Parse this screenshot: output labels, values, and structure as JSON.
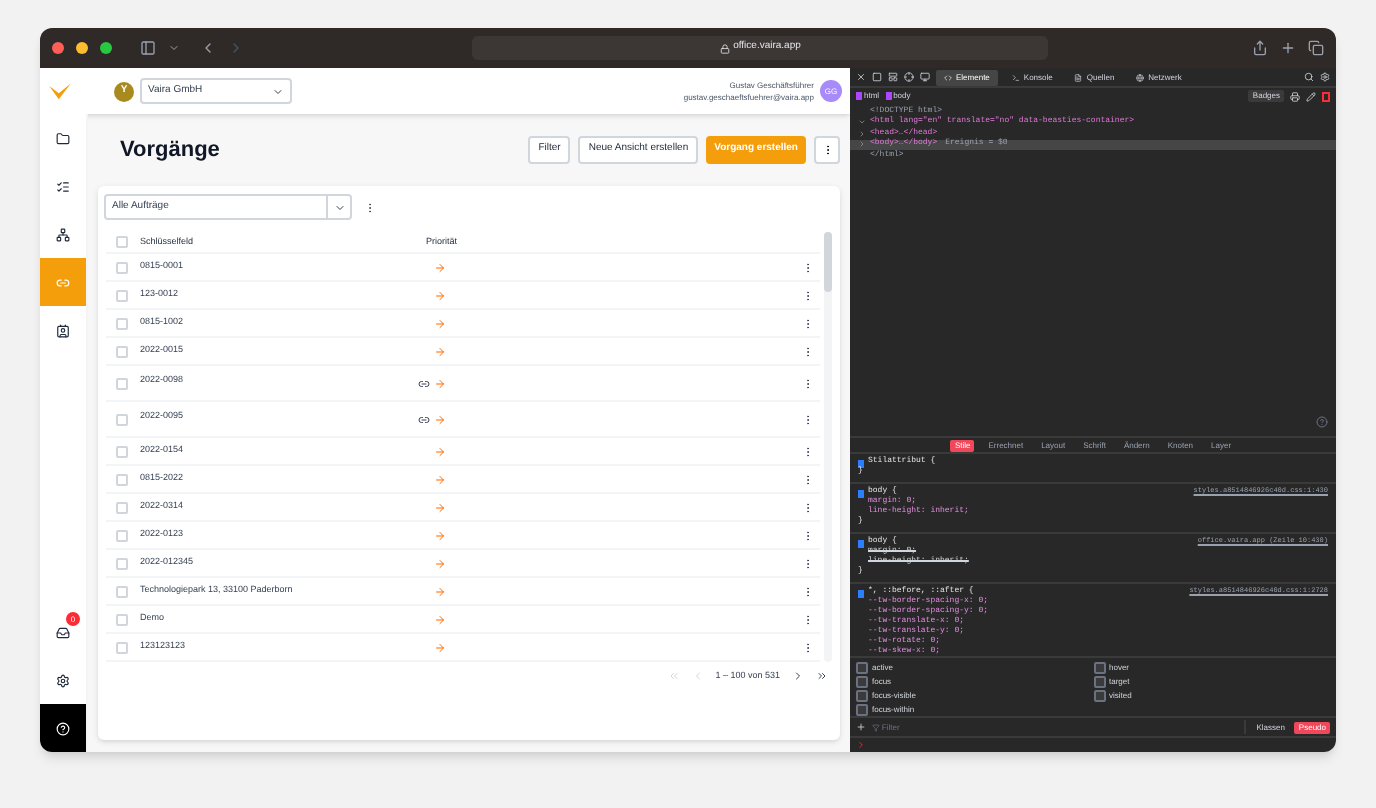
{
  "browser": {
    "url": "office.vaira.app"
  },
  "header": {
    "company_avatar": "Y",
    "company": "Vaira GmbH",
    "user_name": "Gustav Geschäftsführer",
    "user_email": "gustav.geschaeftsfuehrer@vaira.app",
    "user_initials": "GG"
  },
  "sidebar": {
    "items": [
      {
        "selected": false
      },
      {
        "selected": false
      },
      {
        "selected": false
      },
      {
        "selected": true
      },
      {
        "selected": false
      }
    ],
    "bottom_items": [
      {
        "selected": false,
        "badge": "0"
      },
      {
        "selected": false
      },
      {
        "selected": false
      }
    ]
  },
  "page": {
    "title": "Vorgänge",
    "buttons": [
      {
        "label": "Filter",
        "kind": "secondary"
      },
      {
        "label": "Neue Ansicht erstellen",
        "kind": "secondary"
      },
      {
        "label": "Vorgang erstellen",
        "kind": "primary"
      }
    ]
  },
  "table": {
    "view": "Alle Aufträge",
    "select_all_checked": false,
    "columns": [
      "Schlüsselfeld",
      "Priorität"
    ],
    "rows": [
      {
        "key": "0815-0001",
        "linked": false,
        "checked": false
      },
      {
        "key": "123-0012",
        "linked": false,
        "checked": false
      },
      {
        "key": "0815-1002",
        "linked": false,
        "checked": false
      },
      {
        "key": "2022-0015",
        "linked": false,
        "checked": false
      },
      {
        "key": "2022-0098",
        "linked": true,
        "checked": false
      },
      {
        "key": "2022-0095",
        "linked": true,
        "checked": false
      },
      {
        "key": "2022-0154",
        "linked": false,
        "checked": false
      },
      {
        "key": "0815-2022",
        "linked": false,
        "checked": false
      },
      {
        "key": "2022-0314",
        "linked": false,
        "checked": false
      },
      {
        "key": "2022-0123",
        "linked": false,
        "checked": false
      },
      {
        "key": "2022-012345",
        "linked": false,
        "checked": false
      },
      {
        "key": "Technologiepark 13, 33100 Paderborn",
        "linked": false,
        "checked": false
      },
      {
        "key": "Demo",
        "linked": false,
        "checked": false
      },
      {
        "key": "123123123",
        "linked": false,
        "checked": false
      }
    ],
    "pagination": "1 – 100 von 531"
  },
  "devtools": {
    "tabs": [
      {
        "label": "Elemente",
        "selected": true
      },
      {
        "label": "Konsole",
        "selected": false
      },
      {
        "label": "Quellen",
        "selected": false
      },
      {
        "label": "Netzwerk",
        "selected": false
      }
    ],
    "breadcrumb": [
      "html",
      "body"
    ],
    "badges": "Badges",
    "dom": [
      {
        "text": "<!DOCTYPE html>",
        "selected": false
      },
      {
        "text": "<html lang=\"en\" translate=\"no\" data-beasties-container>",
        "expanded": true,
        "selected": false
      },
      {
        "text": "<head>…</head>",
        "expanded": false,
        "selected": false
      },
      {
        "text": "<body>…</body>",
        "note": "Ereignis = $0",
        "expanded": false,
        "selected": true
      },
      {
        "text": "</html>",
        "selected": false
      }
    ],
    "style_tabs": [
      {
        "label": "Stile",
        "selected": true
      },
      {
        "label": "Errechnet",
        "selected": false
      },
      {
        "label": "Layout",
        "selected": false
      },
      {
        "label": "Schrift",
        "selected": false
      },
      {
        "label": "Ändern",
        "selected": false
      },
      {
        "label": "Knoten",
        "selected": false
      },
      {
        "label": "Layer",
        "selected": false
      }
    ],
    "rules": [
      {
        "selector": "Stilattribut {",
        "end": "}"
      },
      {
        "selector": "body {",
        "source": "styles.a8514846926c40d.css:1:430",
        "declarations": [
          {
            "text": "margin: 0;",
            "struck": false
          },
          {
            "text": "line-height: inherit;",
            "struck": false
          }
        ],
        "end": "}"
      },
      {
        "selector": "body {",
        "source": "office.vaira.app (Zeile 10:430)",
        "declarations": [
          {
            "text": "margin: 0;",
            "struck": true
          },
          {
            "text": "line-height: inherit;",
            "struck": true
          }
        ],
        "end": "}"
      },
      {
        "selector": "*, ::before, ::after {",
        "source": "styles.a8514846926c40d.css:1:2728",
        "declarations": [
          {
            "text": "--tw-border-spacing-x: 0;",
            "struck": false
          },
          {
            "text": "--tw-border-spacing-y: 0;",
            "struck": false
          },
          {
            "text": "--tw-translate-x: 0;",
            "struck": false
          },
          {
            "text": "--tw-translate-y: 0;",
            "struck": false
          },
          {
            "text": "--tw-rotate: 0;",
            "struck": false
          },
          {
            "text": "--tw-skew-x: 0;",
            "struck": false
          }
        ]
      }
    ],
    "pseudo_classes": [
      {
        "label": "active",
        "checked": false
      },
      {
        "label": "hover",
        "checked": false
      },
      {
        "label": "focus",
        "checked": false
      },
      {
        "label": "target",
        "checked": false
      },
      {
        "label": "focus-visible",
        "checked": false
      },
      {
        "label": "visited",
        "checked": false
      },
      {
        "label": "focus-within",
        "checked": false
      }
    ],
    "filter_placeholder": "Filter",
    "filter_buttons": [
      {
        "label": "Klassen",
        "selected": false
      },
      {
        "label": "Pseudo",
        "selected": true
      }
    ]
  }
}
